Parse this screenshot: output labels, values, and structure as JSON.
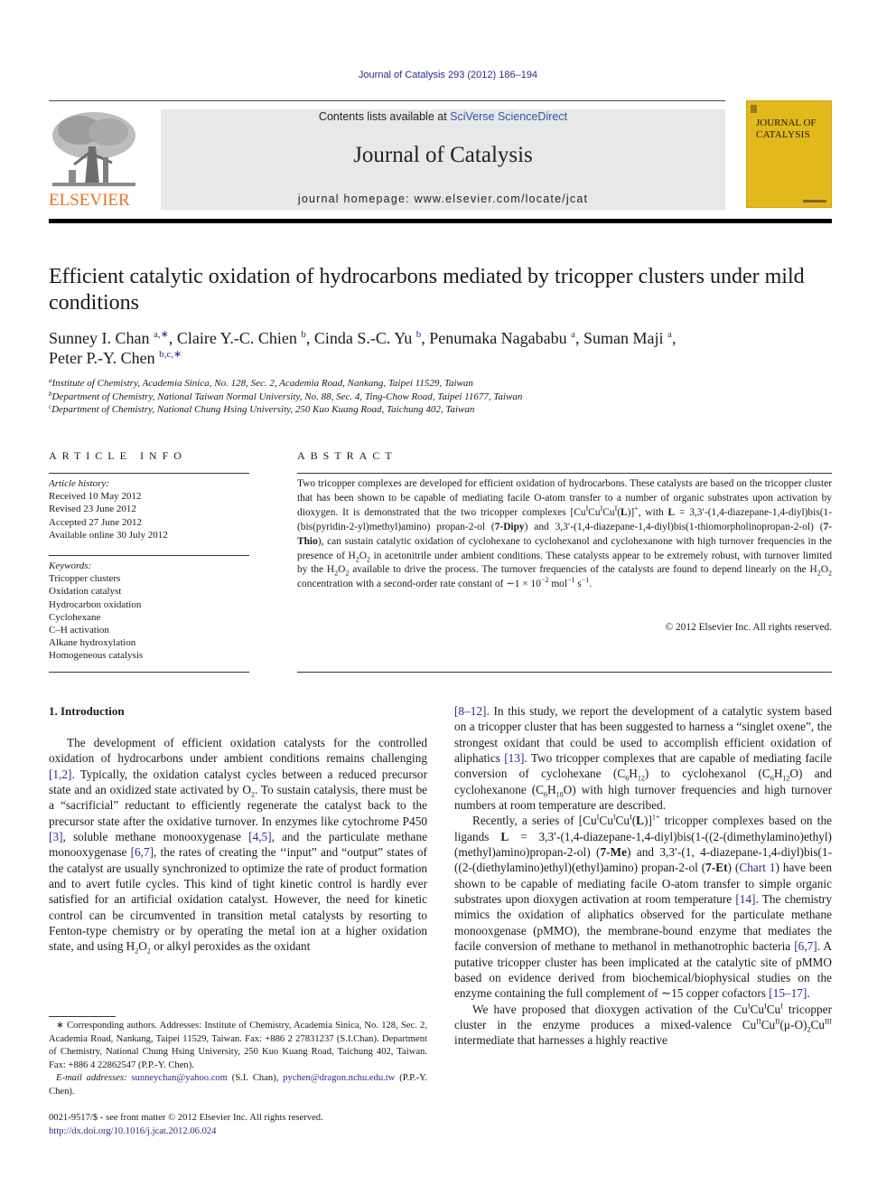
{
  "running_head": "Journal of Catalysis 293 (2012) 186–194",
  "masthead": {
    "contents_prefix": "Contents lists available at ",
    "contents_link": "SciVerse ScienceDirect",
    "journal_title": "Journal of Catalysis",
    "homepage": "journal homepage: www.elsevier.com/locate/jcat",
    "publisher_wordmark": "ELSEVIER",
    "cover_title_line1": "JOURNAL OF",
    "cover_title_line2": "CATALYSIS"
  },
  "colors": {
    "link": "#2b2b8a",
    "elsevier_orange": "#f0711f",
    "cover_yellow": "#e3b81c",
    "masthead_grey": "#e8e8e8"
  },
  "article": {
    "title": "Efficient catalytic oxidation of hydrocarbons mediated by tricopper clusters under mild conditions",
    "authors": [
      {
        "name": "Sunney I. Chan",
        "marks": "a,∗",
        "sep": ", "
      },
      {
        "name": "Claire Y.-C. Chien",
        "marks": "b",
        "sep": ", "
      },
      {
        "name": "Cinda S.-C. Yu",
        "marks": "b",
        "sep": ", "
      },
      {
        "name": "Penumaka Nagababu",
        "marks": "a",
        "sep": ", "
      },
      {
        "name": "Suman Maji",
        "marks": "a",
        "sep": ","
      },
      {
        "name": "Peter P.-Y. Chen",
        "marks": "b,c,∗",
        "sep": ""
      }
    ],
    "affiliations": [
      {
        "mark": "a",
        "text": "Institute of Chemistry, Academia Sinica, No. 128, Sec. 2, Academia Road, Nankang, Taipei 11529, Taiwan"
      },
      {
        "mark": "b",
        "text": "Department of Chemistry, National Taiwan Normal University, No. 88, Sec. 4, Ting-Chow Road, Taipei 11677, Taiwan"
      },
      {
        "mark": "c",
        "text": "Department of Chemistry, National Chung Hsing University, 250 Kuo Kuang Road, Taichung 402, Taiwan"
      }
    ]
  },
  "article_info": {
    "heading": "ARTICLE INFO",
    "history_label": "Article history:",
    "history": [
      "Received 10 May 2012",
      "Revised 23 June 2012",
      "Accepted 27 June 2012",
      "Available online 30 July 2012"
    ],
    "keywords_label": "Keywords:",
    "keywords": [
      "Tricopper clusters",
      "Oxidation catalyst",
      "Hydrocarbon oxidation",
      "Cyclohexane",
      "C–H activation",
      "Alkane hydroxylation",
      "Homogeneous catalysis"
    ]
  },
  "abstract": {
    "heading": "ABSTRACT",
    "s1": "Two tricopper complexes are developed for efficient oxidation of hydrocarbons. These catalysts are based on the tricopper cluster that has been shown to be capable of mediating facile O-atom transfer to a number of organic substrates upon activation by dioxygen. It is demonstrated that the two tricopper complexes [Cu",
    "ox1": "I",
    "cu2": "Cu",
    "ox2": "I",
    "cu3": "Cu",
    "ox3": "I",
    "ligand_open": "(",
    "ligand_L": "L",
    "ligand_close": ")]",
    "charge": "+",
    "s2": ",  with ",
    "L_label": "L",
    "s3": " = 3,3′-(1,4-diazepane-1,4-diyl)bis(1-(bis(pyridin-2-yl)methyl)amino) propan-2-ol (",
    "dipy": "7-Dipy",
    "s4": ") and 3,3′-(1,4-diazepane-1,4-diyl)bis(1-thiomorpholinopropan-2-ol) (",
    "thio": "7-Thio",
    "s5": "), can sustain catalytic oxidation of cyclohexane to cyclohexanol and cyclohexanone with high turnover frequencies in the presence of H",
    "sub2a": "2",
    "o_a": "O",
    "sub2b": "2",
    "s6": " in acetonitrile under ambient conditions. These catalysts appear to be extremely robust, with turnover limited by the H",
    "sub2c": "2",
    "o_b": "O",
    "sub2d": "2",
    "s7": " available to drive the process. The turnover frequencies of the catalysts are found to depend linearly on the H",
    "sub2e": "2",
    "o_c": "O",
    "sub2f": "2",
    "s8": " concentration with a second-order rate constant of ∼1 × 10",
    "exp1": "−2",
    "s9": " mol",
    "exp2": "−1",
    "s10": " s",
    "exp3": "−1",
    "s11": ".",
    "copyright": "© 2012 Elsevier Inc. All rights reserved."
  },
  "introduction": {
    "heading": "1. Introduction",
    "p1": {
      "a": "The development of efficient oxidation catalysts for the controlled oxidation of hydrocarbons under ambient conditions remains challenging ",
      "ref1": "[1,2]",
      "b": ". Typically, the oxidation catalyst cycles between a reduced precursor state and an oxidized state activated by O",
      "sub1": "2",
      "c": ". To sustain catalysis, there must be a “sacrificial” reductant to efficiently regenerate the catalyst back to the precursor state after the oxidative turnover. In enzymes like cytochrome P450 ",
      "ref2": "[3]",
      "d": ", soluble methane monooxygenase ",
      "ref3": "[4,5]",
      "e": ", and the particulate methane monooxygenase ",
      "ref4": "[6,7]",
      "f": ", the rates of creating the ‘‘input” and “output” states of the catalyst are usually synchronized to optimize the rate of product formation and to avert futile cycles. This kind of tight kinetic control is hardly ever satisfied for an artificial oxidation catalyst. However, the need for kinetic control can be circumvented in transition metal catalysts by resorting to Fenton-type chemistry or by operating the metal ion at a higher oxidation state, and using H",
      "sub2": "2",
      "g": "O",
      "sub3": "2",
      "h": " or alkyl peroxides as the oxidant"
    },
    "p1_cont": {
      "ref": "[8–12]",
      "a": ". In this study, we report the development of a catalytic system based on a tricopper cluster that has been suggested to harness a “singlet oxene”, the strongest oxidant that could be used to accomplish efficient oxidation of aliphatics ",
      "ref2": "[13]",
      "b": ". Two tricopper complexes that are capable of mediating facile conversion of cyclohexane (C",
      "s6a": "6",
      "h1": "H",
      "s12a": "12",
      "c": ") to cyclohexanol (C",
      "s6b": "6",
      "h2": "H",
      "s12b": "12",
      "d": "O) and cyclohexanone (C",
      "s6c": "6",
      "h3": "H",
      "s10": "10",
      "e": "O) with high turnover frequencies and high turnover numbers at room temperature are described."
    },
    "p2": {
      "a": "Recently, a series of [Cu",
      "ox1": "I",
      "cu2": "Cu",
      "ox2": "I",
      "cu3": "Cu",
      "ox3": "I",
      "open": "(",
      "L": "L",
      "close": ")]",
      "charge": "1+",
      "b": " tricopper complexes based on the ligands ",
      "L2": "L",
      "c": " = 3,3′-(1,4-diazepane-1,4-diyl)bis(1-((2-(dimethylamino)ethyl)(methyl)amino)propan-2-ol) (",
      "me": "7-Me",
      "d": ") and 3,3′-(1, 4-diazepane-1,4-diyl)bis(1-((2-(diethylamino)ethyl)(ethyl)amino) propan-2-ol (",
      "et": "7-Et",
      "e": ") (",
      "chart": "Chart 1",
      "f": ") have been shown to be capable of mediating facile O-atom transfer to simple organic substrates upon dioxygen activation at room temperature ",
      "ref1": "[14]",
      "g": ". The chemistry mimics the oxidation of aliphatics observed for the particulate methane monooxgenase (pMMO), the membrane-bound enzyme that mediates the facile conversion of methane to methanol in methanotrophic bacteria ",
      "ref2": "[6,7]",
      "h": ". A putative tricopper cluster has been implicated at the catalytic site of pMMO based on evidence derived from biochemical/biophysical studies on the enzyme containing the full complement of ∼15 copper cofactors ",
      "ref3": "[15–17]",
      "i": "."
    },
    "p3": {
      "a": "We have proposed that dioxygen activation of the Cu",
      "ox1": "I",
      "cu2": "Cu",
      "ox2": "I",
      "cu3": "Cu",
      "ox3": "I",
      "b": " tricopper cluster in the enzyme produces a mixed-valence Cu",
      "ox4": "II",
      "cu5": "Cu",
      "ox5": "II",
      "c": "(μ-O)",
      "sub": "2",
      "cu6": "Cu",
      "ox6": "III",
      "d": " intermediate that harnesses a highly reactive"
    }
  },
  "footnote": {
    "star": "∗",
    "corresponding": " Corresponding authors. Addresses: Institute of Chemistry, Academia Sinica, No. 128, Sec. 2, Academia Road, Nankang, Taipei 11529, Taiwan. Fax: +886 2 27831237 (S.I.Chan). Department of Chemistry, National Chung Hsing University, 250 Kuo Kuang Road, Taichung 402, Taiwan. Fax: +886 4 22862547 (P.P.-Y. Chen).",
    "email_label": "E-mail addresses:",
    "email1": "sunneychan@yahoo.com",
    "email1_owner": " (S.I. Chan), ",
    "email2": "pychen@dragon.nchu.edu.tw",
    "email2_owner": " (P.P.-Y. Chen)."
  },
  "front_matter": {
    "issn_line": "0021-9517/$ - see front matter © 2012 Elsevier Inc. All rights reserved.",
    "doi": "http://dx.doi.org/10.1016/j.jcat.2012.06.024"
  }
}
